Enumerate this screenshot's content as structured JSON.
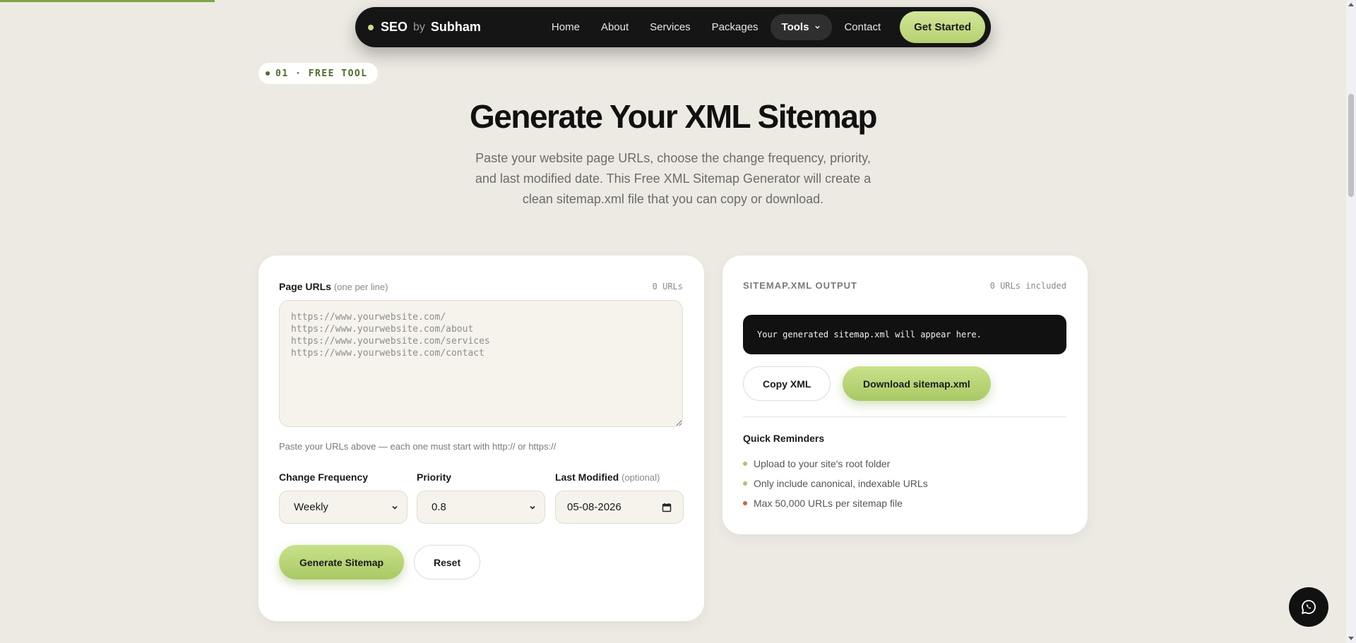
{
  "navbar": {
    "logo_seo": "SEO",
    "logo_by": "by",
    "logo_name": "Subham",
    "links": [
      "Home",
      "About",
      "Services",
      "Packages"
    ],
    "tools_label": "Tools",
    "contact_label": "Contact",
    "cta_label": "Get Started"
  },
  "hero": {
    "badge": "01 · FREE TOOL",
    "title": "Generate Your XML Sitemap",
    "subtitle": "Paste your website page URLs, choose the change frequency, priority, and last modified date. This Free XML Sitemap Generator will create a clean sitemap.xml file that you can copy or download."
  },
  "form": {
    "urls_label": "Page URLs",
    "urls_label_note": "(one per line)",
    "url_count": "0 URLs",
    "urls_placeholder": "https://www.yourwebsite.com/\nhttps://www.yourwebsite.com/about\nhttps://www.yourwebsite.com/services\nhttps://www.yourwebsite.com/contact",
    "hint": "Paste your URLs above — each one must start with http:// or https://",
    "freq_label": "Change Frequency",
    "freq_value": "Weekly",
    "priority_label": "Priority",
    "priority_value": "0.8",
    "lastmod_label": "Last Modified",
    "lastmod_note": "(optional)",
    "lastmod_value": "05-08-2026",
    "generate_label": "Generate Sitemap",
    "reset_label": "Reset"
  },
  "output": {
    "title": "SITEMAP.XML OUTPUT",
    "count": "0 URLs included",
    "placeholder": "Your generated sitemap.xml will appear here.",
    "copy_label": "Copy XML",
    "download_label": "Download sitemap.xml",
    "reminders_title": "Quick Reminders",
    "reminders": [
      {
        "text": "Upload to your site's root folder",
        "color": "#a6c86a"
      },
      {
        "text": "Only include canonical, indexable URLs",
        "color": "#a6c86a"
      },
      {
        "text": "Max 50,000 URLs per sitemap file",
        "color": "#c0683f"
      }
    ]
  },
  "colors": {
    "accent": "#b5d16f",
    "badge_text": "#4d6d2c",
    "dark": "#151515"
  }
}
